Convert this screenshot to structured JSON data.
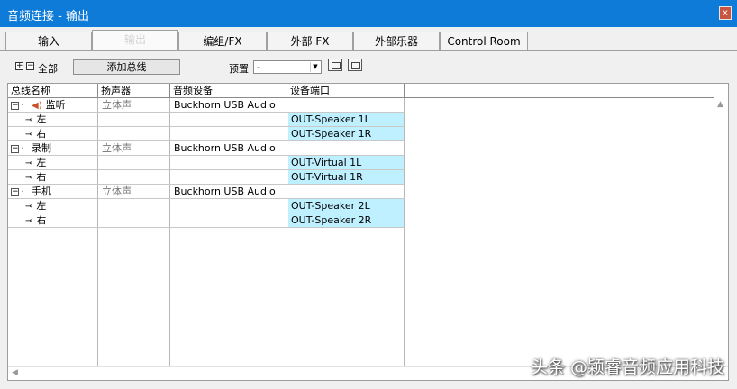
{
  "window": {
    "title": "音频连接 - 输出",
    "close_label": "x"
  },
  "tabs": [
    {
      "label": "输入"
    },
    {
      "label": "输出"
    },
    {
      "label": "编组/FX"
    },
    {
      "label": "外部 FX"
    },
    {
      "label": "外部乐器"
    },
    {
      "label": "Control Room"
    }
  ],
  "toolbar": {
    "expand_symbol": "+",
    "collapse_symbol": "−",
    "all_label": "全部",
    "add_bus_label": "添加总线",
    "preset_label": "预置",
    "preset_value": "-"
  },
  "columns": [
    "总线名称",
    "扬声器",
    "音频设备",
    "设备端口"
  ],
  "buses": [
    {
      "name": "监听",
      "speaker_icon": true,
      "pan": "立体声",
      "device": "Buckhorn USB Audio",
      "port": "",
      "channels": [
        {
          "name": "左",
          "port": "OUT-Speaker 1L"
        },
        {
          "name": "右",
          "port": "OUT-Speaker 1R"
        }
      ]
    },
    {
      "name": "录制",
      "speaker_icon": false,
      "pan": "立体声",
      "device": "Buckhorn USB Audio",
      "port": "",
      "channels": [
        {
          "name": "左",
          "port": "OUT-Virtual 1L"
        },
        {
          "name": "右",
          "port": "OUT-Virtual 1R"
        }
      ]
    },
    {
      "name": "手机",
      "speaker_icon": false,
      "pan": "立体声",
      "device": "Buckhorn USB Audio",
      "port": "",
      "channels": [
        {
          "name": "左",
          "port": "OUT-Speaker 2L"
        },
        {
          "name": "右",
          "port": "OUT-Speaker 2R"
        }
      ]
    }
  ],
  "watermark": "头条 @颖睿音频应用科技",
  "colors": {
    "titlebar": "#0f7bd8",
    "port_highlight": "#bff0ff",
    "close_button": "#c8553f"
  }
}
